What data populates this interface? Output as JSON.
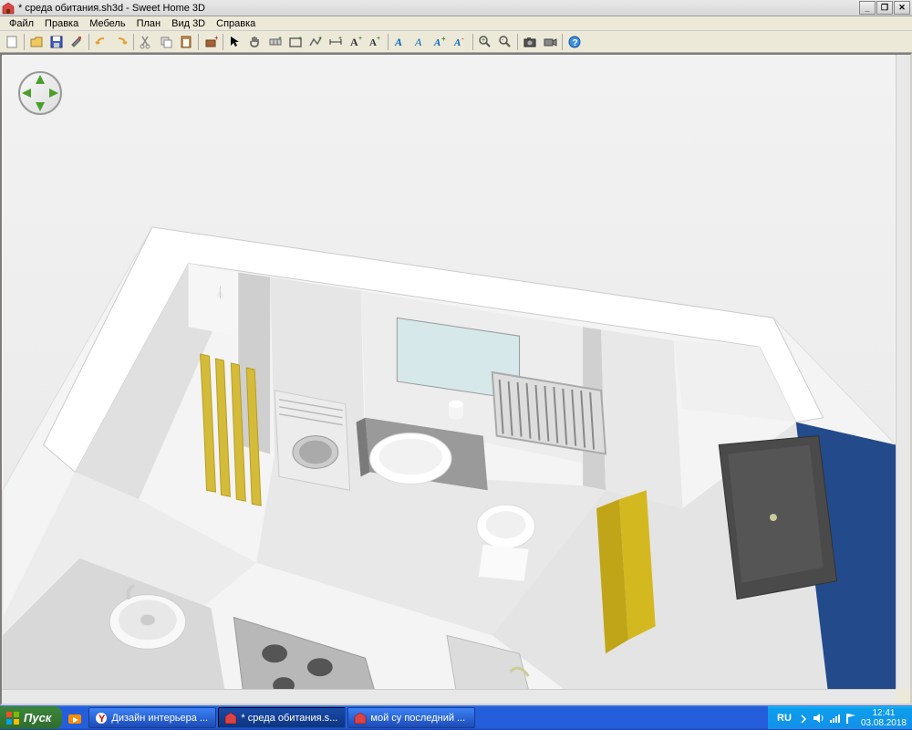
{
  "window": {
    "title": "* среда обитания.sh3d - Sweet Home 3D"
  },
  "menu": {
    "file": "Файл",
    "edit": "Правка",
    "furniture": "Мебель",
    "plan": "План",
    "view3d": "Вид 3D",
    "help": "Справка"
  },
  "taskbar": {
    "start": "Пуск",
    "task1": "Дизайн интерьера ...",
    "task2": "* среда обитания.s...",
    "task3": "мой су последний ...",
    "lang": "RU",
    "time": "12:41",
    "date": "03.08.2018"
  }
}
